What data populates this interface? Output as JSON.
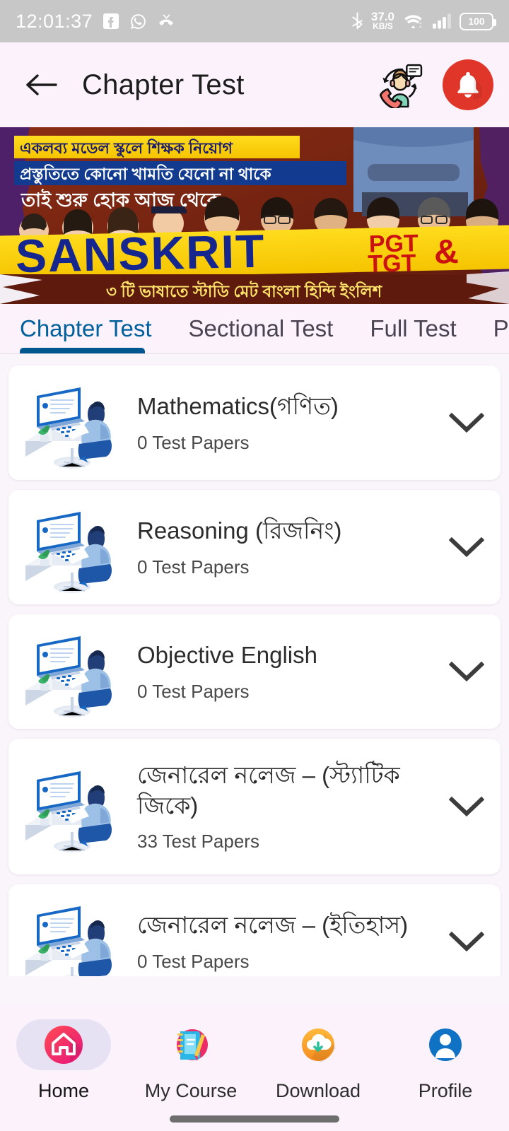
{
  "statusbar": {
    "time": "12:01:37",
    "icons_left": [
      "facebook-icon",
      "whatsapp-icon",
      "missed-call-icon"
    ],
    "bluetooth_icon": "bluetooth-icon",
    "network_speed_value": "37.0",
    "network_speed_unit": "KB/S",
    "wifi_icon": "wifi-icon",
    "signal_icon": "cellular-signal-icon",
    "battery_level": "100"
  },
  "appbar": {
    "back_icon": "back-arrow-icon",
    "title": "Chapter Test",
    "support_icon": "customer-support-icon",
    "bell_icon": "notification-bell-icon",
    "bell_bg": "#e0362a"
  },
  "banner": {
    "line1": "একলব্য মডেল স্কুলে শিক্ষক নিয়োগ",
    "line2": "প্রস্তুতিতে কোনো খামতি যেনো না থাকে",
    "line3": "তাই শুরু হোক আজ থেকে",
    "headline": "SANSKRIT",
    "badge_top": "PGT",
    "badge_amp": "&",
    "badge_bottom": "TGT",
    "footer": "৩ টি ভাষাতে স্টাডি মেট  বাংলা  হিন্দি  ইংলিশ"
  },
  "tabs": {
    "active_index": 0,
    "active_color": "#00609c",
    "items": [
      {
        "label": "Chapter Test"
      },
      {
        "label": "Sectional Test"
      },
      {
        "label": "Full Test"
      },
      {
        "label": "Pre"
      }
    ]
  },
  "list": {
    "chevron_icon": "chevron-down-icon",
    "thumb_icon": "person-at-computer-illustration",
    "items": [
      {
        "title": "Mathematics(গণিত)",
        "papers": "0 Test Papers",
        "two_line": false
      },
      {
        "title": "Reasoning (রিজনিং)",
        "papers": "0 Test Papers",
        "two_line": false
      },
      {
        "title": "Objective English",
        "papers": "0 Test Papers",
        "two_line": false
      },
      {
        "title": "জেনারেল নলেজ – (স্ট্যাটিক জিকে)",
        "papers": "33 Test Papers",
        "two_line": true
      },
      {
        "title": "জেনারেল নলেজ – (ইতিহাস)",
        "papers": "0 Test Papers",
        "two_line": false
      }
    ]
  },
  "bottomnav": {
    "active_index": 0,
    "items": [
      {
        "label": "Home",
        "icon": "home-icon"
      },
      {
        "label": "My Course",
        "icon": "notebook-icon"
      },
      {
        "label": "Download",
        "icon": "download-cloud-icon"
      },
      {
        "label": "Profile",
        "icon": "person-icon"
      }
    ]
  }
}
